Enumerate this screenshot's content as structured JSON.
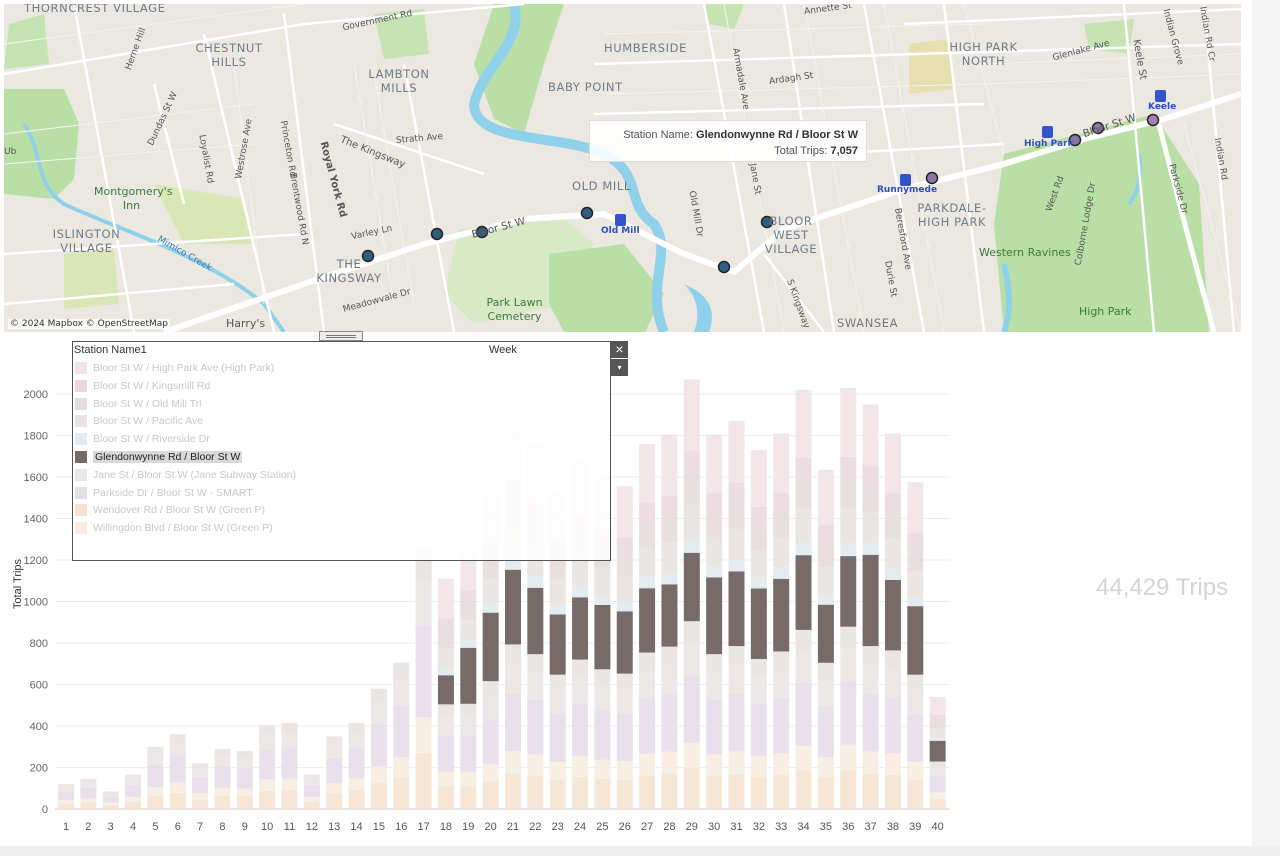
{
  "map": {
    "places": [
      {
        "t": "THORNCREST VILLAGE"
      },
      {
        "t": "CHESTNUT HILLS"
      },
      {
        "t": "LAMBTON MILLS"
      },
      {
        "t": "HUMBERSIDE"
      },
      {
        "t": "BABY POINT"
      },
      {
        "t": "HIGH PARK NORTH"
      },
      {
        "t": "OLD MILL"
      },
      {
        "t": "BLOOR WEST VILLAGE"
      },
      {
        "t": "PARKDALE-HIGH PARK"
      },
      {
        "t": "ISLINGTON VILLAGE"
      },
      {
        "t": "THE KINGSWAY"
      },
      {
        "t": "SWANSEA"
      }
    ],
    "green_places": [
      {
        "t": "Montgomery's Inn"
      },
      {
        "t": "Park Lawn Cemetery"
      },
      {
        "t": "Western Ravines"
      },
      {
        "t": "High Park"
      },
      {
        "t": "Harry's"
      }
    ],
    "roads": [
      {
        "t": "Government Rd"
      },
      {
        "t": "Herne Hill"
      },
      {
        "t": "Dundas St W"
      },
      {
        "t": "Loyalist Rd"
      },
      {
        "t": "Westrose Ave"
      },
      {
        "t": "Princeton Rd"
      },
      {
        "t": "Brentwood Rd N"
      },
      {
        "t": "Royal York Rd"
      },
      {
        "t": "The Kingsway"
      },
      {
        "t": "Strath Ave"
      },
      {
        "t": "Varley Ln"
      },
      {
        "t": "Bloor St W"
      },
      {
        "t": "Armadale Ave"
      },
      {
        "t": "Ardagh St"
      },
      {
        "t": "Jane St"
      },
      {
        "t": "Old Mill Dr"
      },
      {
        "t": "S Kingsway"
      },
      {
        "t": "Beresford Ave"
      },
      {
        "t": "Durie St"
      },
      {
        "t": "West Rd"
      },
      {
        "t": "Colborne Lodge Dr"
      },
      {
        "t": "Parkside Dr"
      },
      {
        "t": "Indian Rd"
      },
      {
        "t": "Keele St"
      },
      {
        "t": "Glenlake Ave"
      },
      {
        "t": "Indian Grove"
      },
      {
        "t": "Meadowvale Dr"
      },
      {
        "t": "Mimico Creek"
      },
      {
        "t": "Annette St"
      },
      {
        "t": "Bloor St W"
      },
      {
        "t": "Indian Rd Cr"
      },
      {
        "t": "Ub"
      }
    ],
    "transit": [
      {
        "t": "Old Mill"
      },
      {
        "t": "Runnymede"
      },
      {
        "t": "High Park"
      },
      {
        "t": "Keele"
      }
    ],
    "attribution": "© 2024 Mapbox © OpenStreetMap",
    "tooltip": {
      "station_label": "Station Name:",
      "station_value": "Glendonwynne Rd / Bloor St W",
      "trips_label": "Total Trips:",
      "trips_value": "7,057"
    }
  },
  "legend": {
    "title": "Station Name1",
    "week_label": "Week",
    "close_icon": "×",
    "menu_icon": "▾",
    "items": [
      {
        "label": "Bloor St W / High Park Ave (High Park)",
        "color": "#f2e3e7"
      },
      {
        "label": "Bloor St W / Kingsmill Rd",
        "color": "#e9d9df"
      },
      {
        "label": "Bloor St W / Old Mill Trl",
        "color": "#e5dcdb"
      },
      {
        "label": "Bloor St W / Pacific Ave",
        "color": "#e8e3e1"
      },
      {
        "label": "Bloor St W / Riverside Dr",
        "color": "#e1eaee"
      },
      {
        "label": "Glendonwynne Rd / Bloor St W",
        "color": "#766b69"
      },
      {
        "label": "Jane St / Bloor St W (Jane Subway Station)",
        "color": "#ebe6e6"
      },
      {
        "label": "Parkside Dr / Bloor St W - SMART",
        "color": "#e5dde8"
      },
      {
        "label": "Wendover Rd / Bloor St W (Green P)",
        "color": "#f5e3d1"
      },
      {
        "label": "Willingdon Blvd / Bloor St W (Green P)",
        "color": "#f6ece1"
      }
    ]
  },
  "chart": {
    "ylabel": "Total Trips",
    "total": "44,429 Trips"
  },
  "chart_data": {
    "type": "bar",
    "stacked": true,
    "xlabel": "Week",
    "ylabel": "Total Trips",
    "ylim": [
      0,
      2150
    ],
    "yticks": [
      0,
      200,
      400,
      600,
      800,
      1000,
      1200,
      1400,
      1600,
      1800,
      2000
    ],
    "categories": [
      "1",
      "2",
      "3",
      "4",
      "5",
      "6",
      "7",
      "8",
      "9",
      "10",
      "11",
      "12",
      "13",
      "14",
      "15",
      "16",
      "17",
      "18",
      "19",
      "20",
      "21",
      "22",
      "23",
      "24",
      "25",
      "26",
      "27",
      "28",
      "29",
      "30",
      "31",
      "32",
      "33",
      "34",
      "35",
      "36",
      "37",
      "38",
      "39",
      "40"
    ],
    "highlight": "Glendonwynne Rd / Bloor St W",
    "highlight_values": [
      0,
      0,
      0,
      0,
      0,
      0,
      0,
      0,
      0,
      0,
      0,
      0,
      0,
      0,
      0,
      0,
      0,
      140,
      270,
      330,
      360,
      320,
      290,
      300,
      310,
      300,
      310,
      300,
      330,
      370,
      360,
      340,
      350,
      360,
      280,
      340,
      440,
      340,
      330,
      100
    ],
    "totals": [
      120,
      145,
      85,
      165,
      300,
      360,
      220,
      290,
      280,
      405,
      415,
      165,
      350,
      415,
      580,
      705,
      1255,
      1110,
      1245,
      1515,
      1885,
      1755,
      1535,
      1685,
      1605,
      1555,
      1760,
      1805,
      2070,
      1805,
      1870,
      1730,
      1810,
      2020,
      1635,
      2030,
      1950,
      1810,
      1575,
      540
    ]
  }
}
